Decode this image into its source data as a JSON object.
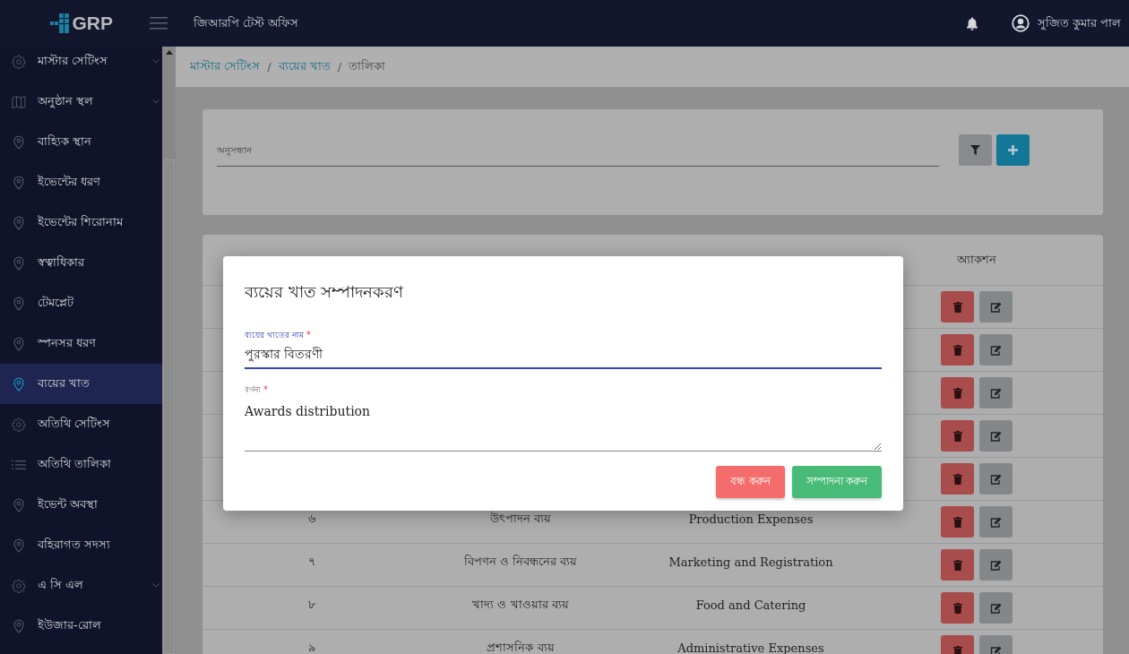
{
  "topbar": {
    "logo": "GRP",
    "office": "জিআরপি টেস্ট অফিস",
    "user": "সুজিত কুমার পাল"
  },
  "sidebar": {
    "items": [
      {
        "label": "মাস্টার সেটিংস",
        "kind": "gear",
        "expandable": true,
        "selected": false
      },
      {
        "label": "অনুষ্ঠান স্থল",
        "kind": "map",
        "expandable": true,
        "selected": false
      },
      {
        "label": "বাহ্যিক স্থান",
        "kind": "pin",
        "expandable": false,
        "selected": false
      },
      {
        "label": "ইভেন্টের ধরণ",
        "kind": "pin",
        "expandable": false,
        "selected": false
      },
      {
        "label": "ইভেন্টের শিরোনাম",
        "kind": "pin",
        "expandable": false,
        "selected": false
      },
      {
        "label": "স্বত্বাধিকার",
        "kind": "pin",
        "expandable": false,
        "selected": false
      },
      {
        "label": "টেমপ্লেট",
        "kind": "pin",
        "expandable": false,
        "selected": false
      },
      {
        "label": "স্পনসর ধরণ",
        "kind": "pin",
        "expandable": false,
        "selected": false
      },
      {
        "label": "ব্যয়ের খাত",
        "kind": "pin",
        "expandable": false,
        "selected": true
      },
      {
        "label": "অতিথি সেটিংস",
        "kind": "gear",
        "expandable": false,
        "selected": false
      },
      {
        "label": "অতিথি তালিকা",
        "kind": "list",
        "expandable": false,
        "selected": false
      },
      {
        "label": "ইভেন্ট অবস্থা",
        "kind": "pin",
        "expandable": false,
        "selected": false
      },
      {
        "label": "বহিরাগত সদস্য",
        "kind": "pin",
        "expandable": false,
        "selected": false
      },
      {
        "label": "এ সি এল",
        "kind": "gear",
        "expandable": true,
        "selected": false
      },
      {
        "label": "ইউজার-রোল",
        "kind": "pin",
        "expandable": false,
        "selected": false
      }
    ]
  },
  "breadcrumb": [
    {
      "label": "মাস্টার সেটিংস",
      "kind": "link"
    },
    {
      "separator": "/",
      "label": "ব্যয়ের খাত",
      "kind": "link"
    },
    {
      "separator": "/",
      "label": "তালিকা",
      "kind": "current"
    }
  ],
  "search": {
    "placeholder": "অনুসন্ধান"
  },
  "table": {
    "columns": [
      {
        "label": "অ্যাকশন"
      }
    ],
    "rows": [
      {
        "kind": "covered"
      },
      {
        "kind": "covered"
      },
      {
        "kind": "covered"
      },
      {
        "kind": "covered"
      },
      {
        "kind": "covered"
      },
      {
        "kind": "data",
        "serial": "৬",
        "name": "উৎপাদন ব্যয়",
        "description": "Production Expenses"
      },
      {
        "kind": "data",
        "serial": "৭",
        "name": "বিপণন ও নিবন্ধনের ব্যয়",
        "description": "Marketing and Registration"
      },
      {
        "kind": "data",
        "serial": "৮",
        "name": "খাদ্য ও খাওয়ার ব্যয়",
        "description": "Food and Catering"
      },
      {
        "kind": "data",
        "serial": "৯",
        "name": "প্রশাসনিক ব্যয়",
        "description": "Administrative Expenses"
      }
    ]
  },
  "dialog": {
    "title": "ব্যয়ের খাত সম্পাদনকরণ",
    "fields": [
      {
        "label": "ব্যয়ের খাতের নাম",
        "required_mark": "*",
        "value": "পুরস্কার বিতরণী",
        "kind": "input",
        "focused": true
      },
      {
        "label": "বর্ণনা",
        "required_mark": "*",
        "value": "Awards distribution",
        "kind": "textarea",
        "focused": false
      }
    ],
    "buttons": [
      {
        "label": "বন্ধ করুন",
        "kind": "close"
      },
      {
        "label": "সম্পাদনা করুন",
        "kind": "submit"
      }
    ]
  }
}
